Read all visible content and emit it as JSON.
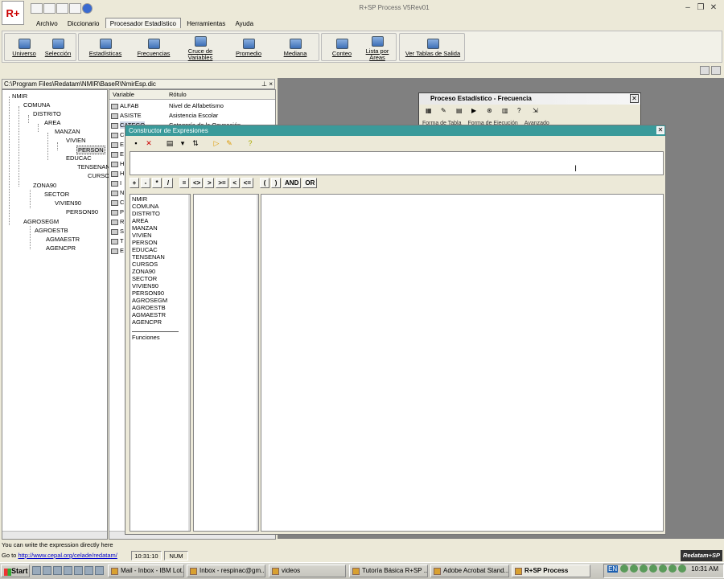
{
  "app": {
    "title": "R+SP Process V5Rev01",
    "logo": "R+"
  },
  "menu": [
    "Archivo",
    "Diccionario",
    "Procesador Estadístico",
    "Herramientas",
    "Ayuda"
  ],
  "ribbon": {
    "buttons": [
      "Universo",
      "Selección",
      "Estadísticas",
      "Frecuencias",
      "Cruce de Variables",
      "Promedio",
      "Mediana",
      "Conteo",
      "Lista por Áreas",
      "Ver Tablas de Salida"
    ]
  },
  "path": {
    "text": "C:\\Program Files\\Redatam\\NMIR\\BaseR\\NmirEsp.dic",
    "pin": "⊥",
    "close": "×"
  },
  "tree": [
    {
      "label": "NMIR"
    },
    {
      "label": "COMUNA"
    },
    {
      "label": "DISTRITO"
    },
    {
      "label": "AREA"
    },
    {
      "label": "MANZAN"
    },
    {
      "label": "VIVIEN"
    },
    {
      "label": "PERSON"
    },
    {
      "label": "EDUCAC"
    },
    {
      "label": "TENSENAN"
    },
    {
      "label": "CURSO"
    },
    {
      "label": "ZONA90"
    },
    {
      "label": "SECTOR"
    },
    {
      "label": "VIVIEN90"
    },
    {
      "label": "PERSON90"
    },
    {
      "label": "AGROSEGM"
    },
    {
      "label": "AGROESTB"
    },
    {
      "label": "AGMAESTR"
    },
    {
      "label": "AGENCPR"
    }
  ],
  "varlist": {
    "headers": [
      "Variable",
      "Rótulo"
    ],
    "rows": [
      {
        "name": "ALFAB",
        "label": "Nivel de Alfabetismo"
      },
      {
        "name": "ASISTE",
        "label": "Asistencia Escolar"
      },
      {
        "name": "CATEGO",
        "label": "Categoría de la Ocupación"
      },
      {
        "name": "C",
        "label": ""
      },
      {
        "name": "E",
        "label": ""
      },
      {
        "name": "E",
        "label": ""
      },
      {
        "name": "H",
        "label": ""
      },
      {
        "name": "H",
        "label": ""
      },
      {
        "name": "I",
        "label": ""
      },
      {
        "name": "N",
        "label": ""
      },
      {
        "name": "C",
        "label": ""
      },
      {
        "name": "P",
        "label": ""
      },
      {
        "name": "R",
        "label": ""
      },
      {
        "name": "S",
        "label": ""
      },
      {
        "name": "T",
        "label": ""
      },
      {
        "name": "E",
        "label": ""
      }
    ]
  },
  "proceso": {
    "title": "Proceso Estadístico - Frecuencia",
    "tabs": [
      "Forma de Tabla",
      "Forma de Ejecución",
      "Avanzado"
    ]
  },
  "constructor": {
    "title": "Constructor de Expresiones",
    "operators": [
      "+",
      "-",
      "*",
      "/",
      "=",
      "<>",
      ">",
      ">=",
      "<",
      "<=",
      "(",
      ")",
      "AND",
      "OR"
    ],
    "entities": [
      "NMIR",
      "COMUNA",
      "DISTRITO",
      "AREA",
      "MANZAN",
      "VIVIEN",
      "PERSON",
      "EDUCAC",
      "TENSENAN",
      "CURSOS",
      "ZONA90",
      "SECTOR",
      "VIVIEN90",
      "PERSON90",
      "AGROSEGM",
      "AGROESTB",
      "AGMAESTR",
      "AGENCPR"
    ],
    "functions_label": "Funciones"
  },
  "status": {
    "hint": "You can write the expression directly here",
    "goto_label": "Go to",
    "goto_link": "http://www.cepal.org/celade/redatam/",
    "time": "10:31:10",
    "num": "NUM",
    "brand": "Redatam+SP"
  },
  "taskbar": {
    "start": "Start",
    "tasks": [
      "Mail - Inbox - IBM Lot...",
      "Inbox - respinac@gm...",
      "videos",
      "Tutoría Básica R+SP ...",
      "Adobe Acrobat Stand...",
      "R+SP Process"
    ],
    "lang": "EN",
    "clock": "10:31 AM"
  }
}
